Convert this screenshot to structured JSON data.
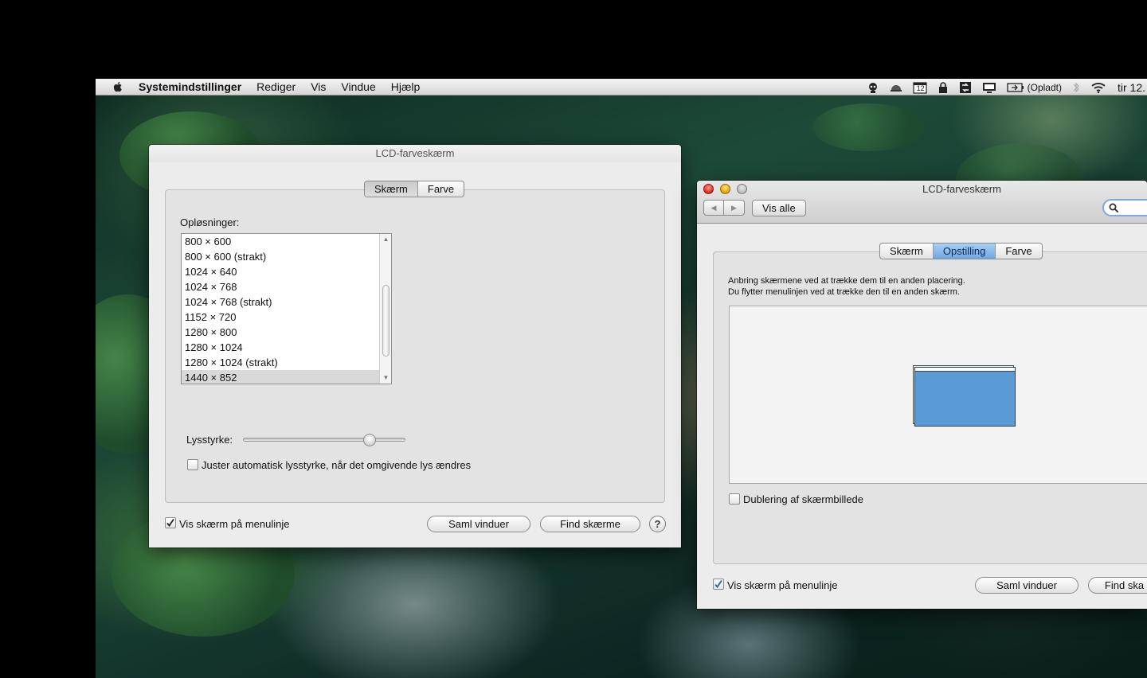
{
  "menubar": {
    "app_name": "Systemindstillinger",
    "items": [
      "Rediger",
      "Vis",
      "Vindue",
      "Hjælp"
    ],
    "battery_label": "(Opladt)",
    "calendar_day": "12",
    "clock": "tir 12."
  },
  "window_left": {
    "title": "LCD-farveskærm",
    "tabs": [
      "Skærm",
      "Farve"
    ],
    "selected_tab": "Skærm",
    "resolutions_label": "Opløsninger:",
    "resolutions": [
      "800 × 600",
      "800 × 600 (strakt)",
      "1024 × 640",
      "1024 × 768",
      "1024 × 768 (strakt)",
      "1152 × 720",
      "1280 × 800",
      "1280 × 1024",
      "1280 × 1024 (strakt)",
      "1440 × 852"
    ],
    "selected_resolution": "1440 × 852",
    "brightness_label": "Lysstyrke:",
    "brightness_level": 0.78,
    "auto_brightness_label": "Juster automatisk lysstyrke, når det omgivende lys ændres",
    "auto_brightness_checked": false,
    "show_in_menubar_label": "Vis skærm på menulinje",
    "show_in_menubar_checked": true,
    "gather_button": "Saml vinduer",
    "detect_button": "Find skærme",
    "help_button": "?"
  },
  "window_right": {
    "title": "LCD-farveskærm",
    "show_all_button": "Vis alle",
    "tabs": [
      "Skærm",
      "Opstilling",
      "Farve"
    ],
    "selected_tab": "Opstilling",
    "instructions_line1": "Anbring skærmene ved at trække dem til en anden placering.",
    "instructions_line2": "Du flytter menulinjen ved at trække den til en anden skærm.",
    "mirror_label": "Dublering af skærmbillede",
    "mirror_checked": false,
    "show_in_menubar_label": "Vis skærm på menulinje",
    "show_in_menubar_checked": true,
    "gather_button": "Saml vinduer",
    "detect_button": "Find ska"
  },
  "colors": {
    "display_blue": "#5b9bd5",
    "selected_tab_blue": "#6fa8e6",
    "checkbox_blue": "#2f6fc0"
  }
}
